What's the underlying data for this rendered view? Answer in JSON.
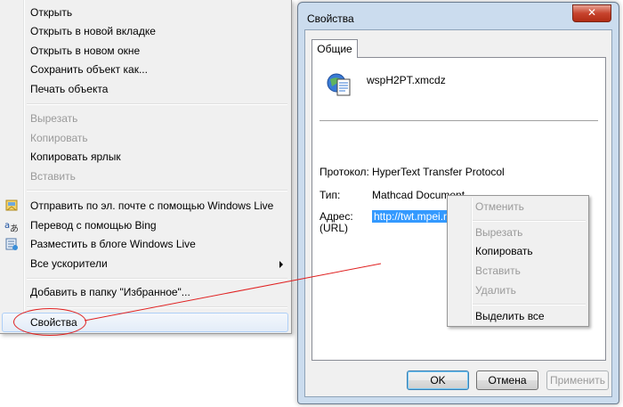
{
  "context_menu": {
    "items": [
      {
        "label": "Открыть",
        "disabled": false
      },
      {
        "label": "Открыть в новой вкладке",
        "disabled": false
      },
      {
        "label": "Открыть в новом окне",
        "disabled": false
      },
      {
        "label": "Сохранить объект как...",
        "disabled": false
      },
      {
        "label": "Печать объекта",
        "disabled": false
      },
      {
        "label": "Вырезать",
        "disabled": true
      },
      {
        "label": "Копировать",
        "disabled": true
      },
      {
        "label": "Копировать ярлык",
        "disabled": false
      },
      {
        "label": "Вставить",
        "disabled": true
      },
      {
        "label": "Отправить по эл. почте с помощью Windows Live",
        "icon": "email-icon"
      },
      {
        "label": "Перевод с помощью Bing",
        "icon": "translate-icon"
      },
      {
        "label": "Разместить в блоге Windows Live",
        "icon": "blog-icon"
      },
      {
        "label": "Все ускорители",
        "submenu": true
      },
      {
        "label": "Добавить в папку \"Избранное\"..."
      },
      {
        "label": "Свойства",
        "highlighted": true
      }
    ]
  },
  "dialog": {
    "title": "Свойства",
    "close_glyph": "✕",
    "tab": "Общие",
    "file_name": "wspH2PT.xmcdz",
    "protocol_label": "Протокол:",
    "protocol_value": "HyperText Transfer Protocol",
    "type_label": "Тип:",
    "type_value": "Mathcad Document",
    "address_label": "Адрес:",
    "address_label2": "(URL)",
    "address_value": "http://twt.mpei.ru/tbtpp/wspH2PT.xmcdz",
    "ok_label": "OK",
    "cancel_label": "Отмена",
    "apply_label": "Применить"
  },
  "edit_menu": {
    "undo": "Отменить",
    "cut": "Вырезать",
    "copy": "Копировать",
    "paste": "Вставить",
    "delete": "Удалить",
    "select_all": "Выделить все"
  },
  "colors": {
    "annotation": "#e02020",
    "selection": "#3399ff"
  }
}
